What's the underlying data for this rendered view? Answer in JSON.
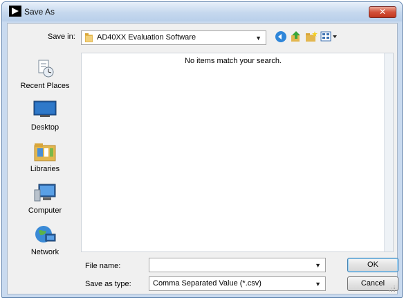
{
  "window": {
    "title": "Save As",
    "close_label": "✕"
  },
  "toolbar": {
    "save_in_label": "Save in:",
    "save_in_value": "AD40XX Evaluation Software",
    "dropdown_arrow": "▼"
  },
  "places": [
    {
      "label": "Recent Places",
      "icon": "recent-places-icon"
    },
    {
      "label": "Desktop",
      "icon": "desktop-icon"
    },
    {
      "label": "Libraries",
      "icon": "libraries-icon"
    },
    {
      "label": "Computer",
      "icon": "computer-icon"
    },
    {
      "label": "Network",
      "icon": "network-icon"
    }
  ],
  "filelist": {
    "empty_message": "No items match your search."
  },
  "form": {
    "file_name_label": "File name:",
    "file_name_value": "",
    "save_type_label": "Save as type:",
    "save_type_value": "Comma Separated Value (*.csv)"
  },
  "buttons": {
    "ok": "OK",
    "cancel": "Cancel"
  },
  "colors": {
    "title_gradient": "#c5d8ee",
    "close": "#c1381f",
    "client": "#f0f0f0"
  }
}
